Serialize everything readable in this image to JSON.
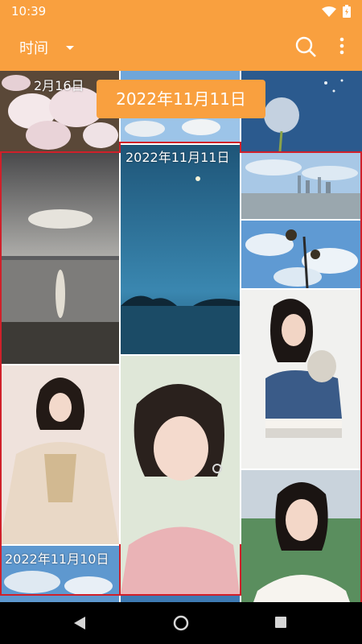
{
  "status": {
    "time": "10:39"
  },
  "appbar": {
    "title": "时间",
    "search_icon": "search-icon",
    "more_icon": "more-vert-icon"
  },
  "scroll_bubble": {
    "text": "2022年11月11日"
  },
  "groups": {
    "feb16": {
      "date": "2月16日"
    },
    "nov11": {
      "date": "2022年11月11日"
    },
    "nov10": {
      "date": "2022年11月10日"
    }
  },
  "colors": {
    "accent": "#f9a03f",
    "selection": "#d0202a"
  }
}
